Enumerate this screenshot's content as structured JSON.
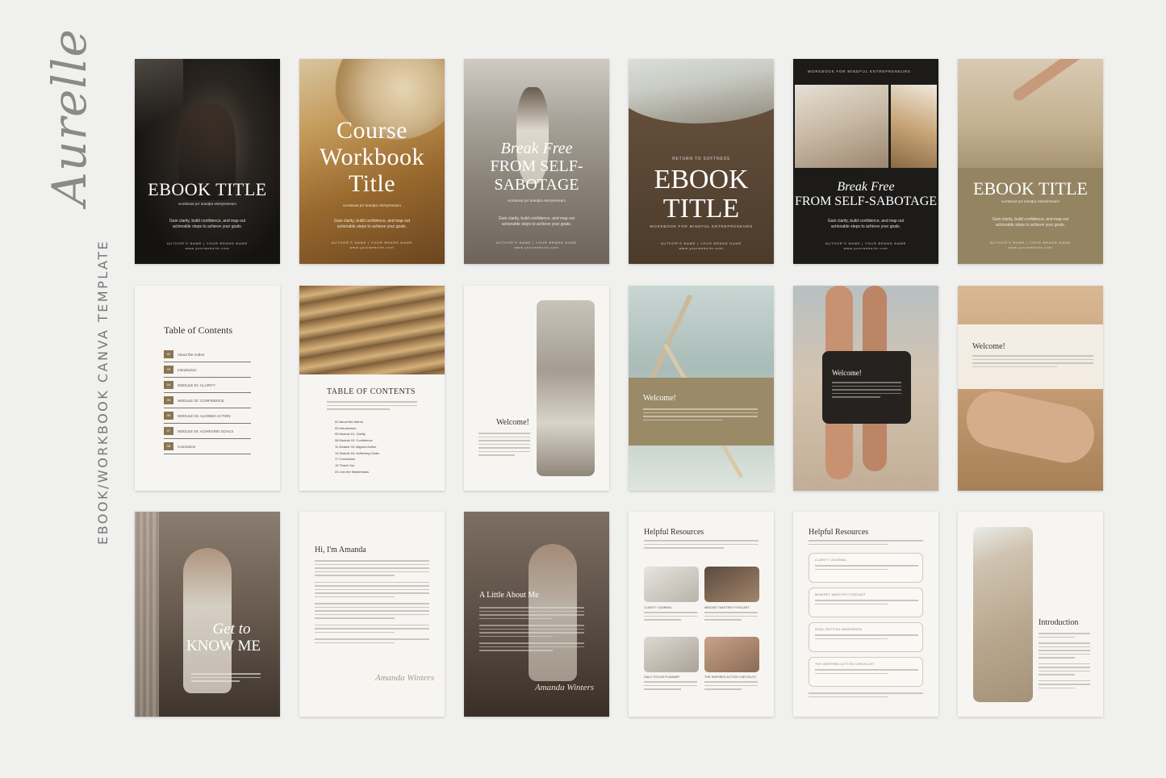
{
  "brand": {
    "name": "Aurelle",
    "subtitle": "EBOOK/WORKBOOK CANVA TEMPLATE"
  },
  "row1": {
    "p1": {
      "title": "EBOOK TITLE",
      "tagline": "workbook for mindful entrepreneurs",
      "desc": "Gain clarity, build confidence, and map out actionable steps to achieve your goals.",
      "author": "AUTHOR'S NAME | YOUR BRAND NAME",
      "site": "www.yourwebsite.com"
    },
    "p2": {
      "title_l1": "Course",
      "title_l2": "Workbook",
      "title_l3": "Title",
      "tagline": "workbook for mindful entrepreneurs",
      "desc": "Gain clarity, build confidence, and map out actionable steps to achieve your goals.",
      "author": "AUTHOR'S NAME | YOUR BRAND NAME",
      "site": "www.yourwebsite.com"
    },
    "p3": {
      "title_l1": "Break Free",
      "title_l2": "FROM SELF-",
      "title_l3": "SABOTAGE",
      "tagline": "workbook for mindful entrepreneurs",
      "desc": "Gain clarity, build confidence, and map out actionable steps to achieve your goals.",
      "author": "AUTHOR'S NAME | YOUR BRAND NAME",
      "site": "www.yourwebsite.com"
    },
    "p4": {
      "kicker": "RETURN TO SOFTNESS",
      "title_l1": "EBOOK",
      "title_l2": "TITLE",
      "sub": "WORKBOOK FOR MINDFUL ENTREPRENEURS",
      "author": "AUTHOR'S NAME | YOUR BRAND NAME",
      "site": "www.yourwebsite.com"
    },
    "p5": {
      "kicker": "WORKBOOK FOR MINDFUL ENTREPRENEURS",
      "title_l1": "Break Free",
      "title_l2": "FROM SELF-SABOTAGE",
      "desc": "Gain clarity, build confidence, and map out actionable steps to achieve your goals.",
      "author": "AUTHOR'S NAME | YOUR BRAND NAME",
      "site": "www.yourwebsite.com"
    },
    "p6": {
      "title": "EBOOK TITLE",
      "tagline": "workbook for mindful entrepreneurs",
      "desc": "Gain clarity, build confidence, and map out actionable steps to achieve your goals.",
      "author": "AUTHOR'S NAME | YOUR BRAND NAME",
      "site": "www.yourwebsite.com"
    }
  },
  "row2": {
    "toc": {
      "title": "Table of Contents",
      "items": [
        {
          "num": "02",
          "label": "About the Author"
        },
        {
          "num": "03",
          "label": "Introduction"
        },
        {
          "num": "04",
          "label": "MODULE 01: CLARITY"
        },
        {
          "num": "05",
          "label": "MODULE 02: CONFIDENCE"
        },
        {
          "num": "06",
          "label": "MODULE 03: ALIGNED ACTION"
        },
        {
          "num": "07",
          "label": "MODULE 04: ACHIEVING GOALS"
        },
        {
          "num": "08",
          "label": "Conclusion"
        }
      ]
    },
    "toc2": {
      "title": "TABLE OF CONTENTS",
      "items": [
        "02  About the Author",
        "03  Introduction",
        "05  Module 01: Clarity",
        "08  Module 02: Confidence",
        "11  Module 03: Aligned Action",
        "14  Module 04: Achieving Goals",
        "17  Conclusion",
        "19  Thank You",
        "20  Join the Masterclass"
      ]
    },
    "welcome": "Welcome!"
  },
  "row3": {
    "getto": {
      "l1": "Get to",
      "l2": "KNOW ME"
    },
    "hi": {
      "title": "Hi, I'm Amanda",
      "sign": "Amanda Winters"
    },
    "little": {
      "title": "A Little About Me",
      "sign": "Amanda Winters"
    },
    "res": {
      "title": "Helpful Resources",
      "items": [
        "CLARITY JOURNAL",
        "MINDSET MASTERY PODCAST",
        "DAILY FOCUS PLANNER",
        "THE INSPIRED ACTION CHECKLIST"
      ]
    },
    "res2": {
      "title": "Helpful Resources",
      "items": [
        "CLARITY JOURNAL",
        "MINDSET MASTERY PODCAST",
        "GOAL-SETTING WORKBOOK",
        "THE INSPIRED ACTION CHECKLIST"
      ]
    },
    "intro": {
      "title": "Introduction"
    }
  }
}
